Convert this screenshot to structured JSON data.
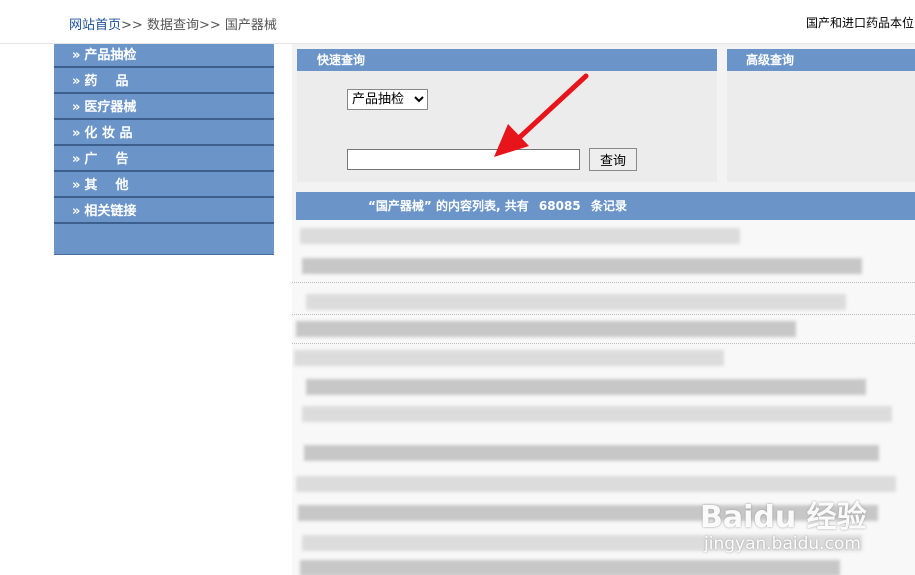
{
  "breadcrumb": {
    "home": "网站首页",
    "sep1": ">>",
    "section": "数据查询",
    "sep2": ">>",
    "current": "国产器械"
  },
  "header_right": "国产和进口药品本位",
  "sidebar": {
    "items": [
      {
        "arrow": "»",
        "label": "产品抽检"
      },
      {
        "arrow": "»",
        "label": "药    品"
      },
      {
        "arrow": "»",
        "label": "医疗器械"
      },
      {
        "arrow": "»",
        "label": "化 妆 品"
      },
      {
        "arrow": "»",
        "label": "广    告"
      },
      {
        "arrow": "»",
        "label": "其    他"
      },
      {
        "arrow": "»",
        "label": "相关链接"
      }
    ]
  },
  "quick_search": {
    "title": "快速查询",
    "select_value": "产品抽检",
    "input_value": "",
    "button_label": "查询"
  },
  "advanced_search": {
    "title": "高级查询"
  },
  "list": {
    "prefix": "“国产器械” 的内容列表, 共有",
    "count": "68085",
    "suffix": "条记录"
  },
  "watermark": {
    "brand": "Baidu 经验",
    "url": "jingyan.baidu.com"
  },
  "colors": {
    "nav_blue": "#6b95c9",
    "accent_red": "#e8141c"
  }
}
